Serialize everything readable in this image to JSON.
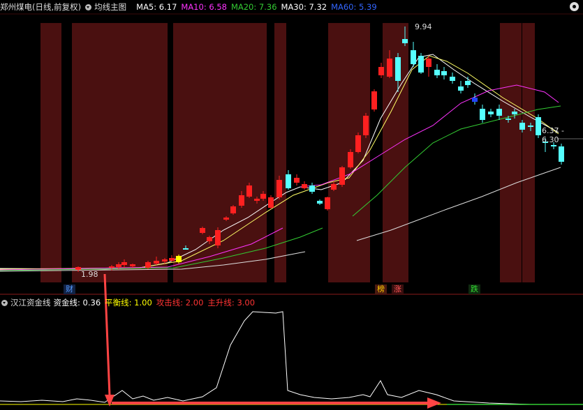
{
  "price_panel": {
    "stock_label": "郑州煤电(日线,前复权)",
    "indicator_label": "均线主图",
    "ma": [
      {
        "label": "MA5: 6.17",
        "color": "#ffffff"
      },
      {
        "label": "MA10: 6.58",
        "color": "#ff33ff"
      },
      {
        "label": "MA20: 7.36",
        "color": "#33cc33"
      },
      {
        "label": "MA30: 7.32",
        "color": "#ffffff"
      },
      {
        "label": "MA60: 5.39",
        "color": "#3366ff"
      }
    ],
    "high_label": "9.94",
    "low_label": "1.98",
    "last_label": "6.37 - 6.30",
    "badges": [
      {
        "text": "财",
        "color": "#5599ff",
        "bg": "#112244"
      },
      {
        "text": "榜",
        "color": "#ffcc00",
        "bg": "#4a1a10"
      },
      {
        "text": "涨",
        "color": "#ff5555",
        "bg": "#3a0f0f"
      },
      {
        "text": "跌",
        "color": "#33dd33",
        "bg": "#0f2a0f"
      }
    ]
  },
  "sub_panel": {
    "title": "汉江资金线",
    "items": [
      {
        "label": "资金线: 0.36",
        "color": "#ffffff"
      },
      {
        "label": "平衡线: 1.00",
        "color": "#ffff00"
      },
      {
        "label": "攻击线: 2.00",
        "color": "#ff3333"
      },
      {
        "label": "主升线: 3.00",
        "color": "#ff3333"
      }
    ]
  },
  "colors": {
    "up": "#ff2020",
    "down": "#55ffff",
    "shade": "#4a1010",
    "bg": "#000000"
  }
}
